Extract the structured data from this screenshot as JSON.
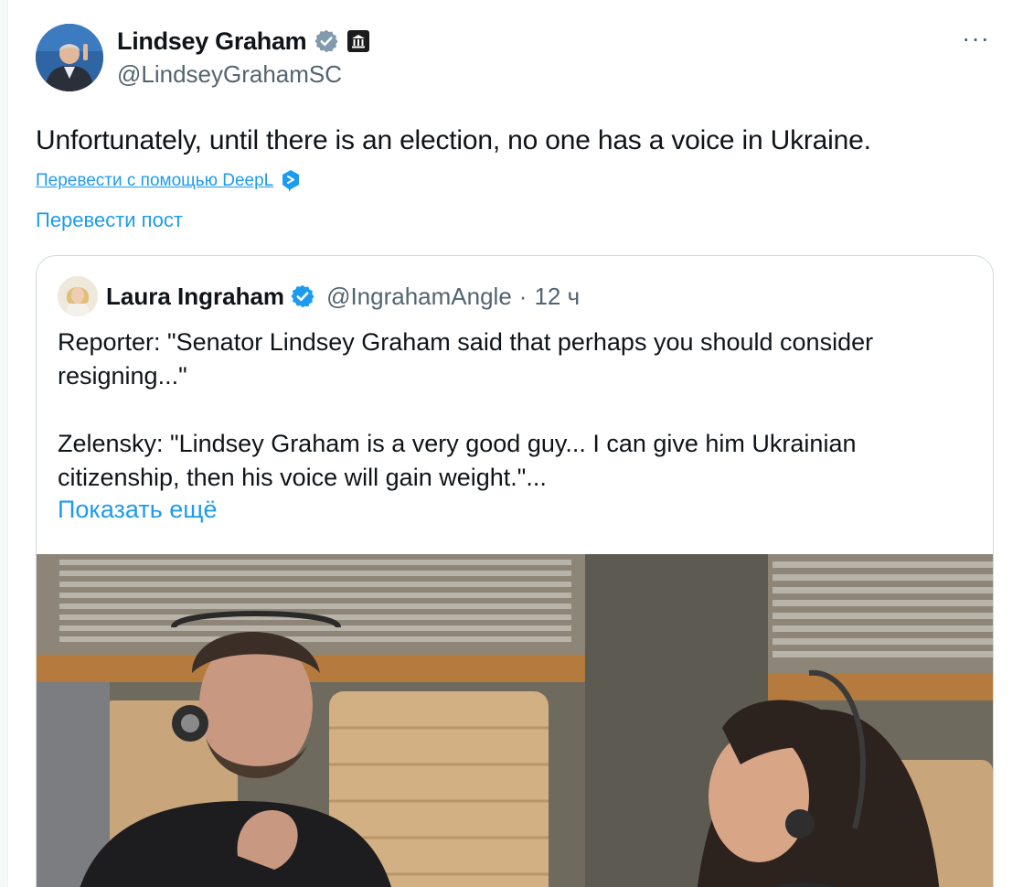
{
  "author": {
    "display_name": "Lindsey Graham",
    "handle": "@LindseyGrahamSC",
    "verified_icon": "verified-badge-icon",
    "affiliation_icon": "government-building-icon"
  },
  "tweet": {
    "text": "Unfortunately, until there is an election, no one has a voice in Ukraine.",
    "deepl_label": "Перевести с помощью DeepL",
    "translate_label": "Перевести пост",
    "more_label": "···"
  },
  "quoted": {
    "display_name": "Laura Ingraham",
    "handle": "@IngrahamAngle",
    "separator": "·",
    "time": "12 ч",
    "paragraph_1": "Reporter: \"Senator Lindsey Graham said that perhaps you should consider resigning...\"",
    "paragraph_2": "Zelensky: \"Lindsey Graham is a very good guy... I can give him Ukrainian citizenship, then his voice will gain weight.\"...",
    "show_more_label": "Показать ещё"
  },
  "colors": {
    "link": "#1d9bf0",
    "secondary_text": "#536471",
    "verified": "#1d9bf0",
    "border": "#cfd9de"
  }
}
